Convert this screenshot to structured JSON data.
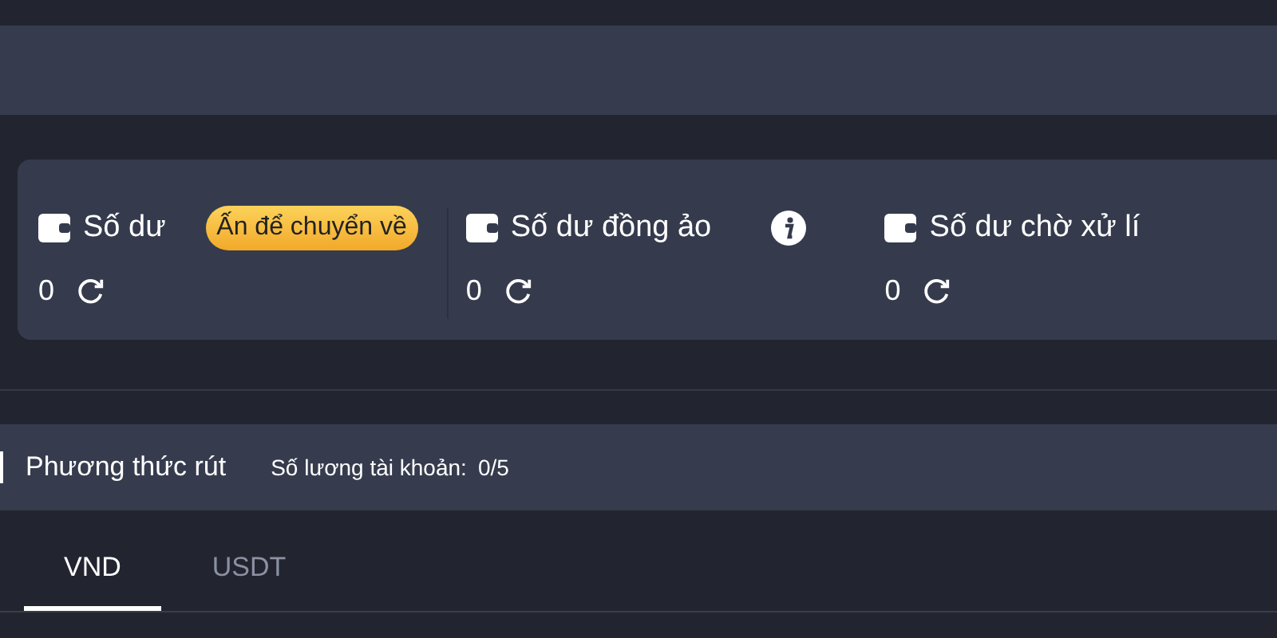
{
  "balances": [
    {
      "label": "Số dư",
      "amount": "0",
      "action": "Ấn để chuyển về"
    },
    {
      "label": "Số dư đồng ảo",
      "amount": "0",
      "info": true
    },
    {
      "label": "Số dư chờ xử lí",
      "amount": "0"
    }
  ],
  "section": {
    "title": "Phương thức rút",
    "count_label": "Số lương tài khoản:",
    "count": "0/5"
  },
  "tabs": [
    {
      "label": "VND",
      "selected": true
    },
    {
      "label": "USDT",
      "selected": false
    }
  ]
}
